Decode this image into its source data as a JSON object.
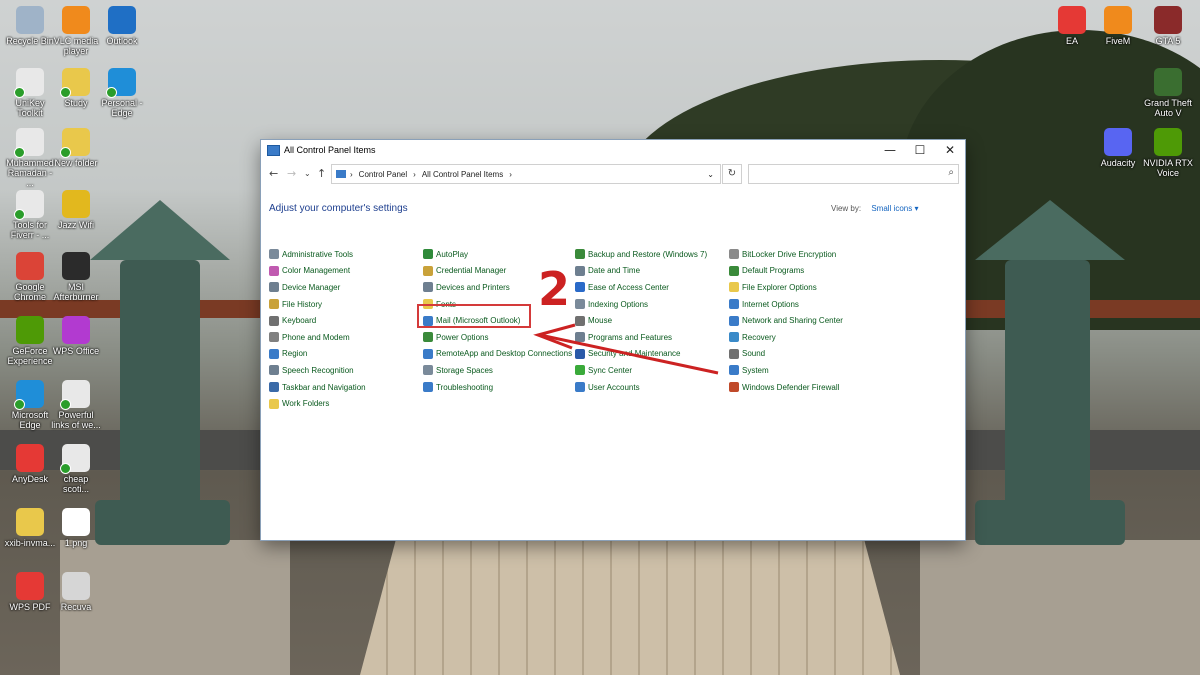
{
  "desktop": {
    "left_icons": [
      {
        "label": "Recycle Bin",
        "color": "#9fb3c8",
        "icon": "recycle-bin-icon"
      },
      {
        "label": "VLC media player",
        "color": "#f08a1c",
        "icon": "vlc-icon"
      },
      {
        "label": "Outlook",
        "color": "#1f6fc5",
        "icon": "outlook-icon"
      },
      {
        "label": "UniKey Toolkit",
        "color": "#e8e8e8",
        "icon": "file-icon"
      },
      {
        "label": "Study",
        "color": "#e9c84b",
        "icon": "folder-icon"
      },
      {
        "label": "Personal - Edge",
        "color": "#1f8ed8",
        "icon": "edge-icon"
      },
      {
        "label": "Muhammed Ramadan - ...",
        "color": "#e8e8e8",
        "icon": "file-icon"
      },
      {
        "label": "New folder",
        "color": "#e9c84b",
        "icon": "folder-icon"
      },
      {
        "label": "Tools for Fiverr - ...",
        "color": "#e8e8e8",
        "icon": "file-icon"
      },
      {
        "label": "Jazz Wifi",
        "color": "#e2b81e",
        "icon": "jazz-icon"
      },
      {
        "label": "Google Chrome",
        "color": "#db4437",
        "icon": "chrome-icon"
      },
      {
        "label": "MSI Afterburner",
        "color": "#2b2b2b",
        "icon": "msi-icon"
      },
      {
        "label": "GeForce Experience",
        "color": "#4e9a06",
        "icon": "nvidia-icon"
      },
      {
        "label": "WPS Office",
        "color": "#b23ad0",
        "icon": "wps-icon"
      },
      {
        "label": "Microsoft Edge",
        "color": "#1f8ed8",
        "icon": "edge-icon"
      },
      {
        "label": "Powerful links of we...",
        "color": "#e8e8e8",
        "icon": "file-icon"
      },
      {
        "label": "AnyDesk",
        "color": "#e53935",
        "icon": "anydesk-icon"
      },
      {
        "label": "cheap scoti...",
        "color": "#e8e8e8",
        "icon": "file-icon"
      },
      {
        "label": "xxib-invma...",
        "color": "#e9c84b",
        "icon": "archive-icon"
      },
      {
        "label": "1.png",
        "color": "#ffffff",
        "icon": "image-file-icon"
      },
      {
        "label": "WPS PDF",
        "color": "#e53935",
        "icon": "wps-pdf-icon"
      },
      {
        "label": "Recuva",
        "color": "#d6d6d6",
        "icon": "recuva-icon"
      }
    ],
    "right_icons": [
      {
        "label": "EA",
        "color": "#e53935",
        "icon": "ea-icon"
      },
      {
        "label": "FiveM",
        "color": "#f08a1c",
        "icon": "fivem-icon"
      },
      {
        "label": "GTA 5",
        "color": "#8a2a2a",
        "icon": "gta5-icon"
      },
      {
        "label": "Grand Theft Auto V",
        "color": "#3a6e30",
        "icon": "gtav-icon"
      },
      {
        "label": "Audacity",
        "color": "#5865f2",
        "icon": "audacity-icon"
      },
      {
        "label": "NVIDIA RTX Voice",
        "color": "#4e9a06",
        "icon": "nvidia-icon"
      }
    ]
  },
  "window": {
    "title": "All Control Panel Items",
    "minimize": "—",
    "maximize": "☐",
    "close": "✕",
    "breadcrumb": [
      "Control Panel",
      "All Control Panel Items"
    ],
    "search_placeholder": "",
    "heading": "Adjust your computer's settings",
    "view_by_label": "View by:",
    "view_by_value": "Small icons ▾",
    "columns": [
      [
        {
          "label": "Administrative Tools",
          "color": "#7a8a9a"
        },
        {
          "label": "Color Management",
          "color": "#c05ab0"
        },
        {
          "label": "Device Manager",
          "color": "#6e7f90"
        },
        {
          "label": "File History",
          "color": "#c9a23a"
        },
        {
          "label": "Keyboard",
          "color": "#707070"
        },
        {
          "label": "Phone and Modem",
          "color": "#808080"
        },
        {
          "label": "Region",
          "color": "#3a7bc8"
        },
        {
          "label": "Speech Recognition",
          "color": "#6e7f90"
        },
        {
          "label": "Taskbar and Navigation",
          "color": "#3a6aa8"
        },
        {
          "label": "Work Folders",
          "color": "#e9c84b"
        }
      ],
      [
        {
          "label": "AutoPlay",
          "color": "#2f8a3a"
        },
        {
          "label": "Credential Manager",
          "color": "#c9a23a"
        },
        {
          "label": "Devices and Printers",
          "color": "#6e7f90"
        },
        {
          "label": "Fonts",
          "color": "#e9c84b"
        },
        {
          "label": "Mail (Microsoft Outlook)",
          "color": "#3a7bc8"
        },
        {
          "label": "Power Options",
          "color": "#3a8a3a"
        },
        {
          "label": "RemoteApp and Desktop Connections",
          "color": "#3a7bc8"
        },
        {
          "label": "Storage Spaces",
          "color": "#7a8a9a"
        },
        {
          "label": "Troubleshooting",
          "color": "#3a7bc8"
        }
      ],
      [
        {
          "label": "Backup and Restore (Windows 7)",
          "color": "#3a8a3a"
        },
        {
          "label": "Date and Time",
          "color": "#6e7f90"
        },
        {
          "label": "Ease of Access Center",
          "color": "#2a6ac8"
        },
        {
          "label": "Indexing Options",
          "color": "#7a8a9a"
        },
        {
          "label": "Mouse",
          "color": "#707070"
        },
        {
          "label": "Programs and Features",
          "color": "#6e7f90"
        },
        {
          "label": "Security and Maintenance",
          "color": "#2a5aa8"
        },
        {
          "label": "Sync Center",
          "color": "#3aaa3a"
        },
        {
          "label": "User Accounts",
          "color": "#3a7bc8"
        }
      ],
      [
        {
          "label": "BitLocker Drive Encryption",
          "color": "#8a8a8a"
        },
        {
          "label": "Default Programs",
          "color": "#3a8a3a"
        },
        {
          "label": "File Explorer Options",
          "color": "#e9c84b"
        },
        {
          "label": "Internet Options",
          "color": "#3a7bc8"
        },
        {
          "label": "Network and Sharing Center",
          "color": "#3a7bc8"
        },
        {
          "label": "Recovery",
          "color": "#3a8ac8"
        },
        {
          "label": "Sound",
          "color": "#707070"
        },
        {
          "label": "System",
          "color": "#3a7bc8"
        },
        {
          "label": "Windows Defender Firewall",
          "color": "#c04a2a"
        }
      ]
    ]
  },
  "annotation": {
    "step_number": "2",
    "color": "#cc2222"
  }
}
